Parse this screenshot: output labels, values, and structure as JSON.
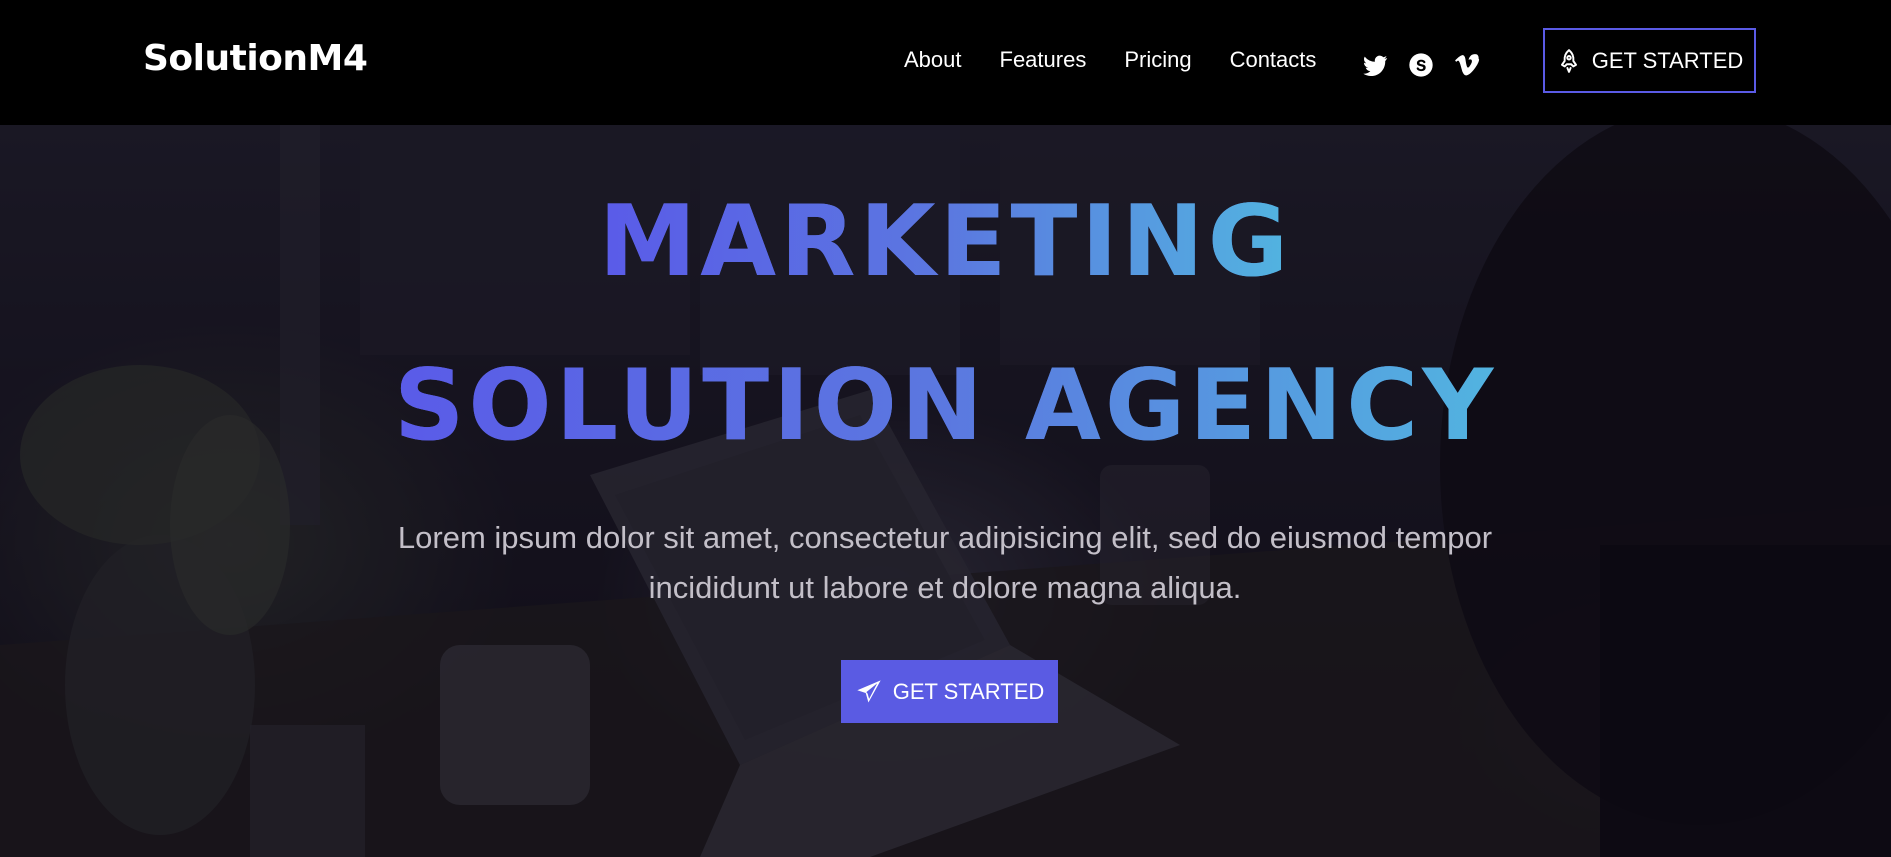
{
  "header": {
    "logo": "SolutionM4",
    "nav": [
      "About",
      "Features",
      "Pricing",
      "Contacts"
    ],
    "social": [
      "twitter-icon",
      "skype-icon",
      "vimeo-icon"
    ],
    "cta_label": "GET STARTED",
    "cta_icon": "rocket-icon",
    "cta_border_color": "#5b5be6"
  },
  "hero": {
    "headline_line1": "MARKETING",
    "headline_line2": "SOLUTION AGENCY",
    "subtitle_line1": "Lorem ipsum dolor sit amet, consectetur adipisicing elit, sed do eiusmod tempor",
    "subtitle_line2": "incididunt ut labore et dolore magna aliqua.",
    "cta_label": "GET STARTED",
    "cta_icon": "paper-plane-icon",
    "cta_color": "#5a5be3",
    "gradient_start": "#5a5be8",
    "gradient_end": "#52b4e0"
  }
}
